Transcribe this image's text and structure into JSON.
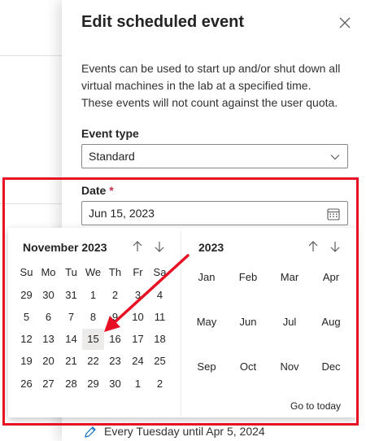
{
  "dialog": {
    "title": "Edit scheduled event",
    "description": "Events can be used to start up and/or shut down all virtual machines in the lab at a specified time. These events will not count against the user quota."
  },
  "event_type": {
    "label": "Event type",
    "value": "Standard"
  },
  "date": {
    "label": "Date",
    "required_mark": "*",
    "value": "Jun 15, 2023"
  },
  "calendar": {
    "month_title": "November 2023",
    "weekdays": [
      "Su",
      "Mo",
      "Tu",
      "We",
      "Th",
      "Fr",
      "Sa"
    ],
    "weeks": [
      [
        "29",
        "30",
        "31",
        "1",
        "2",
        "3",
        "4"
      ],
      [
        "5",
        "6",
        "7",
        "8",
        "9",
        "10",
        "11"
      ],
      [
        "12",
        "13",
        "14",
        "15",
        "16",
        "17",
        "18"
      ],
      [
        "19",
        "20",
        "21",
        "22",
        "23",
        "24",
        "25"
      ],
      [
        "26",
        "27",
        "28",
        "29",
        "30",
        "1",
        "2"
      ]
    ],
    "selected_day": "15",
    "year_title": "2023",
    "months": [
      "Jan",
      "Feb",
      "Mar",
      "Apr",
      "May",
      "Jun",
      "Jul",
      "Aug",
      "Sep",
      "Oct",
      "Nov",
      "Dec"
    ],
    "go_to_today": "Go to today"
  },
  "recurrence": {
    "text": "Every Tuesday until Apr 5, 2024"
  },
  "annotation": {
    "highlight_color": "#e81123",
    "arrow_color": "#e81123"
  }
}
